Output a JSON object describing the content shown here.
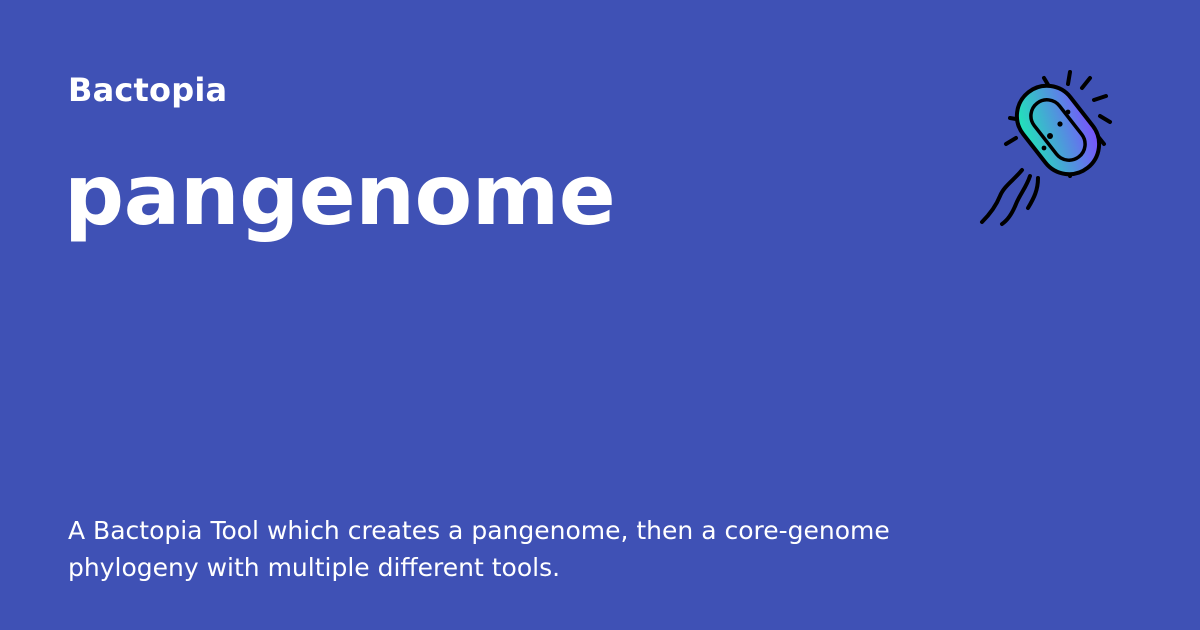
{
  "site": {
    "name": "Bactopia"
  },
  "page": {
    "title": "pangenome",
    "description": "A Bactopia Tool which creates a pangenome, then a core-genome phylogeny with multiple different tools."
  },
  "logo": {
    "icon": "bacterium-icon",
    "gradient_start": "#7c4dff",
    "gradient_end": "#1de9b6",
    "outline": "#000000"
  },
  "colors": {
    "background": "#3f51b5",
    "text": "#ffffff"
  }
}
